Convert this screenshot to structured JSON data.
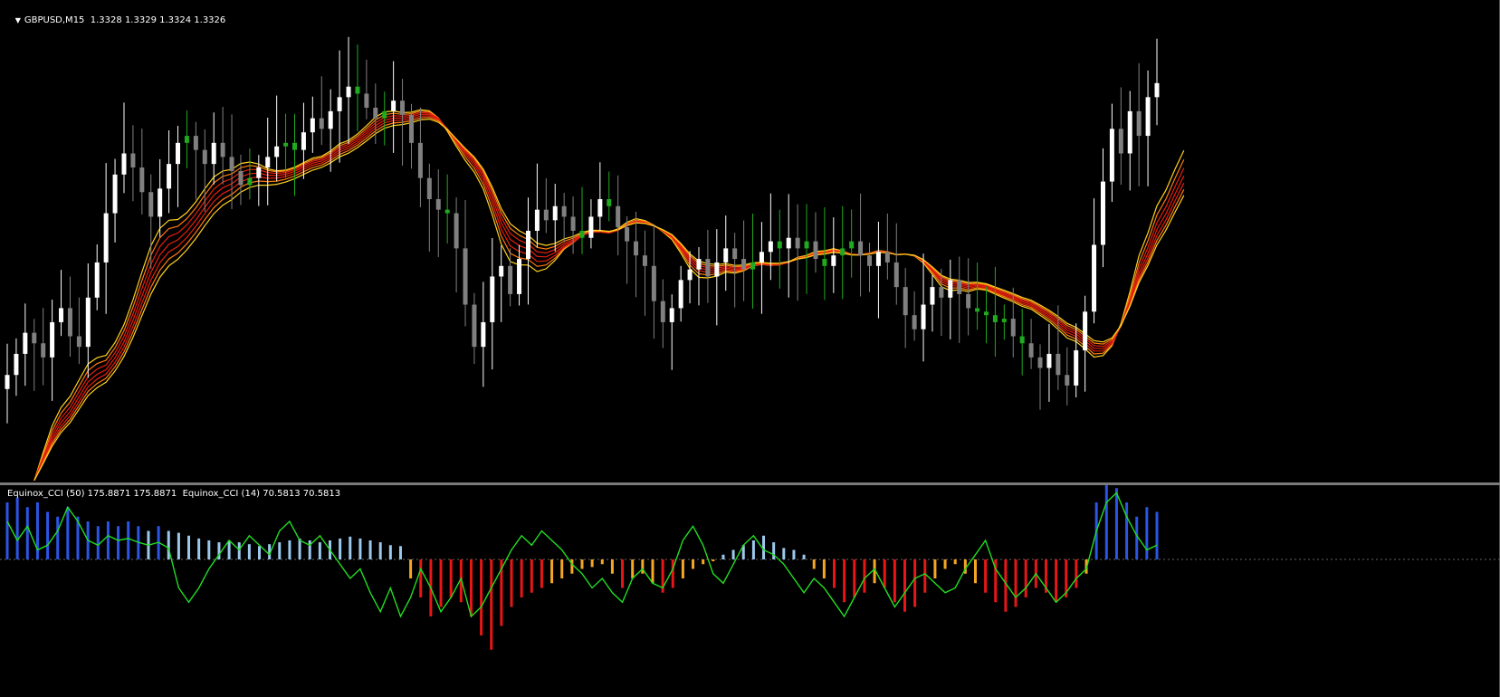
{
  "window": {
    "menu_glyph": "▼",
    "title": "GBPUSD,M15  1.3328 1.3329 1.3324 1.3326"
  },
  "indicator": {
    "title": "Equinox_CCI (50) 175.8871 175.8871  Equinox_CCI (14) 70.5813 70.5813"
  },
  "colors": {
    "background": "#000000",
    "bull_candle": "#ffffff",
    "bear_candle": "#808080",
    "doji_candle": "#1faa1f",
    "ribbon_outer": "#ffd21f",
    "ribbon_mid": "#ff7a10",
    "ribbon_inner": "#e52010",
    "cci_line": "#22dd22",
    "cci_strong_pos": "#2b55e6",
    "cci_weak_pos": "#9cc8ec",
    "cci_strong_neg": "#e81616",
    "cci_weak_neg": "#f5a623",
    "zero_line": "#666666"
  },
  "chart_data": [
    {
      "type": "candlestick",
      "title": "GBPUSD,M15",
      "last_ohlc": {
        "open": 1.3328,
        "high": 1.3329,
        "low": 1.3324,
        "close": 1.3326
      },
      "series": [
        {
          "name": "price_path",
          "values": [
            1.3243,
            1.3249,
            1.3255,
            1.3252,
            1.3248,
            1.3258,
            1.3262,
            1.3254,
            1.3251,
            1.3265,
            1.3275,
            1.3289,
            1.33,
            1.3306,
            1.3302,
            1.3295,
            1.3288,
            1.3296,
            1.3303,
            1.3309,
            1.3311,
            1.3307,
            1.3303,
            1.3309,
            1.3305,
            1.3301,
            1.3297,
            1.3299,
            1.3302,
            1.3305,
            1.3308,
            1.3309,
            1.3307,
            1.3312,
            1.3316,
            1.3313,
            1.3318,
            1.3322,
            1.3325,
            1.3323,
            1.3319,
            1.3316,
            1.3318,
            1.3321,
            1.3317,
            1.3309,
            1.3299,
            1.3293,
            1.329,
            1.3289,
            1.3279,
            1.3263,
            1.3251,
            1.3258,
            1.3271,
            1.3274,
            1.3266,
            1.3276,
            1.3284,
            1.329,
            1.3287,
            1.3291,
            1.3288,
            1.3284,
            1.3282,
            1.3288,
            1.3293,
            1.3291,
            1.3285,
            1.3281,
            1.3277,
            1.3274,
            1.3264,
            1.3258,
            1.3262,
            1.327,
            1.3273,
            1.3276,
            1.3271,
            1.3275,
            1.3279,
            1.3276,
            1.3273,
            1.3275,
            1.3278,
            1.3281,
            1.3279,
            1.3282,
            1.3279,
            1.3281,
            1.3276,
            1.3274,
            1.3277,
            1.3279,
            1.3281,
            1.3277,
            1.3274,
            1.3278,
            1.3275,
            1.3268,
            1.326,
            1.3256,
            1.3263,
            1.3268,
            1.3265,
            1.327,
            1.3266,
            1.3262,
            1.3261,
            1.326,
            1.3258,
            1.3259,
            1.3254,
            1.3252,
            1.3248,
            1.3245,
            1.3249,
            1.3243,
            1.324,
            1.325,
            1.3261,
            1.328,
            1.3298,
            1.3313,
            1.3306,
            1.3318,
            1.3311,
            1.3322,
            1.3326
          ]
        }
      ],
      "ribbon": {
        "lines": 7,
        "colors_outer_to_inner": [
          "yellow",
          "orange",
          "red"
        ]
      }
    },
    {
      "type": "bar",
      "title": "Equinox_CCI",
      "series": [
        {
          "name": "Equinox_CCI (50)",
          "last": 175.8871
        },
        {
          "name": "Equinox_CCI (14)",
          "last": 70.5813
        }
      ],
      "histogram_values": [
        60,
        65,
        55,
        60,
        50,
        45,
        55,
        45,
        40,
        35,
        40,
        35,
        40,
        35,
        30,
        35,
        30,
        28,
        25,
        22,
        20,
        18,
        20,
        18,
        16,
        14,
        16,
        18,
        20,
        22,
        20,
        18,
        20,
        22,
        24,
        22,
        20,
        18,
        15,
        14,
        -20,
        -40,
        -60,
        -50,
        -40,
        -45,
        -60,
        -80,
        -95,
        -70,
        -50,
        -40,
        -35,
        -30,
        -25,
        -20,
        -15,
        -10,
        -8,
        -5,
        -15,
        -30,
        -20,
        -15,
        -25,
        -35,
        -30,
        -20,
        -10,
        -5,
        -2,
        5,
        10,
        15,
        20,
        25,
        18,
        12,
        10,
        5,
        -10,
        -20,
        -30,
        -45,
        -40,
        -35,
        -25,
        -30,
        -45,
        -55,
        -50,
        -35,
        -20,
        -10,
        -5,
        -15,
        -25,
        -35,
        -45,
        -55,
        -50,
        -40,
        -30,
        -35,
        -45,
        -40,
        -30,
        -15,
        60,
        80,
        75,
        60,
        45,
        55,
        50
      ],
      "cci_line": [
        40,
        20,
        35,
        10,
        15,
        30,
        55,
        40,
        20,
        15,
        25,
        20,
        22,
        18,
        15,
        18,
        12,
        -30,
        -45,
        -30,
        -10,
        5,
        20,
        10,
        25,
        15,
        5,
        30,
        40,
        20,
        15,
        25,
        10,
        -5,
        -20,
        -10,
        -35,
        -55,
        -30,
        -60,
        -40,
        -10,
        -30,
        -55,
        -40,
        -20,
        -60,
        -50,
        -30,
        -10,
        10,
        25,
        15,
        30,
        20,
        10,
        -5,
        -15,
        -30,
        -20,
        -35,
        -45,
        -20,
        -10,
        -25,
        -30,
        -10,
        20,
        35,
        15,
        -15,
        -25,
        -5,
        15,
        25,
        10,
        5,
        -5,
        -20,
        -35,
        -20,
        -30,
        -45,
        -60,
        -40,
        -20,
        -10,
        -30,
        -50,
        -35,
        -20,
        -15,
        -25,
        -35,
        -30,
        -10,
        5,
        20,
        -10,
        -25,
        -40,
        -30,
        -15,
        -30,
        -45,
        -35,
        -20,
        -10,
        30,
        60,
        70,
        45,
        25,
        10,
        15
      ]
    }
  ]
}
